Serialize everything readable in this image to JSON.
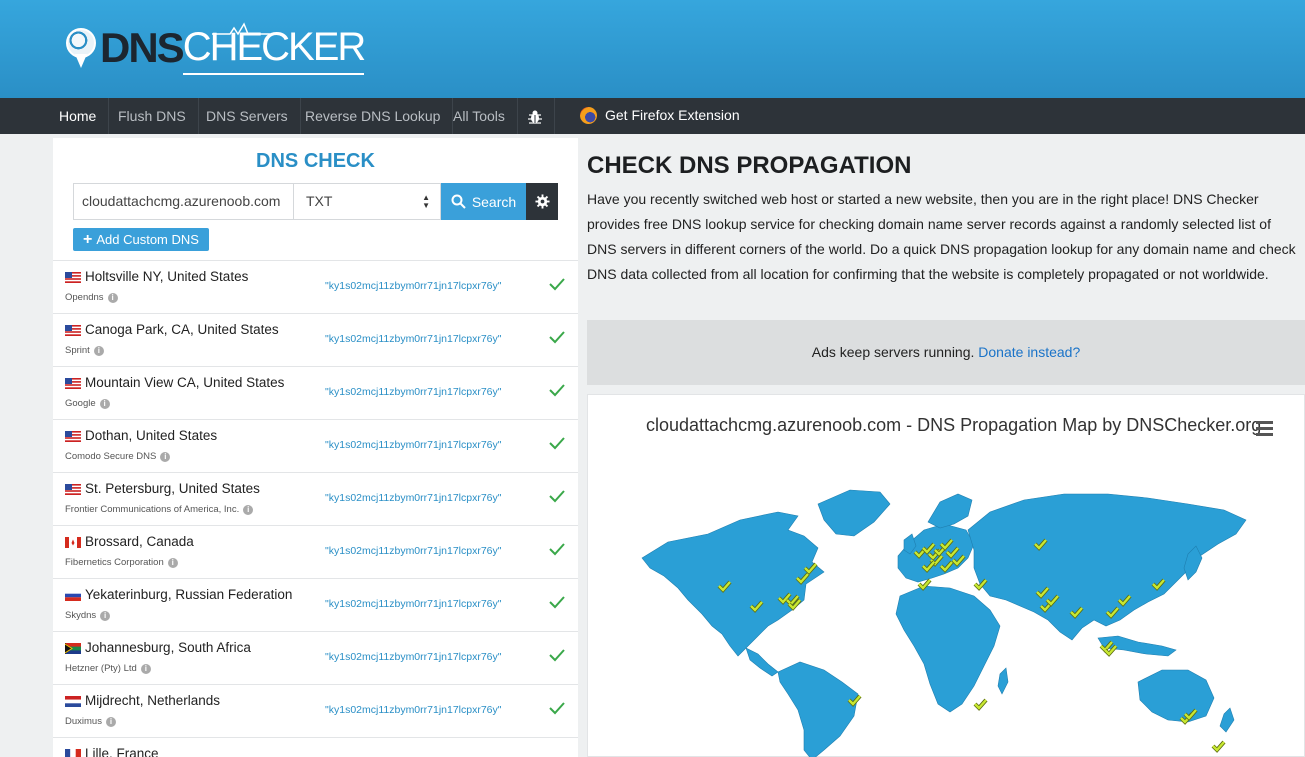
{
  "brand": {
    "part1": "DNS",
    "part2": "CHECKER"
  },
  "nav": {
    "items": [
      {
        "label": "Home"
      },
      {
        "label": "Flush DNS"
      },
      {
        "label": "DNS Servers"
      },
      {
        "label": "Reverse DNS Lookup"
      },
      {
        "label": "All Tools"
      }
    ],
    "firefox_label": "Get Firefox Extension"
  },
  "check": {
    "title": "DNS CHECK",
    "domain_value": "cloudattachcmg.azurenoob.com",
    "record_type": "TXT",
    "search_label": "Search",
    "add_custom_label": "Add Custom DNS"
  },
  "results": [
    {
      "location": "Holtsville NY, United States",
      "provider": "Opendns",
      "value": "\"ky1s02mcj11zbym0rr71jn17lcpxr76y\"",
      "flag": "us"
    },
    {
      "location": "Canoga Park, CA, United States",
      "provider": "Sprint",
      "value": "\"ky1s02mcj11zbym0rr71jn17lcpxr76y\"",
      "flag": "us"
    },
    {
      "location": "Mountain View CA, United States",
      "provider": "Google",
      "value": "\"ky1s02mcj11zbym0rr71jn17lcpxr76y\"",
      "flag": "us"
    },
    {
      "location": "Dothan, United States",
      "provider": "Comodo Secure DNS",
      "value": "\"ky1s02mcj11zbym0rr71jn17lcpxr76y\"",
      "flag": "us"
    },
    {
      "location": "St. Petersburg, United States",
      "provider": "Frontier Communications of America, Inc.",
      "value": "\"ky1s02mcj11zbym0rr71jn17lcpxr76y\"",
      "flag": "us"
    },
    {
      "location": "Brossard, Canada",
      "provider": "Fibernetics Corporation",
      "value": "\"ky1s02mcj11zbym0rr71jn17lcpxr76y\"",
      "flag": "ca"
    },
    {
      "location": "Yekaterinburg, Russian Federation",
      "provider": "Skydns",
      "value": "\"ky1s02mcj11zbym0rr71jn17lcpxr76y\"",
      "flag": "ru"
    },
    {
      "location": "Johannesburg, South Africa",
      "provider": "Hetzner (Pty) Ltd",
      "value": "\"ky1s02mcj11zbym0rr71jn17lcpxr76y\"",
      "flag": "za"
    },
    {
      "location": "Mijdrecht, Netherlands",
      "provider": "Duximus",
      "value": "\"ky1s02mcj11zbym0rr71jn17lcpxr76y\"",
      "flag": "nl"
    },
    {
      "location": "Lille, France",
      "provider": "",
      "value": "",
      "flag": "fr"
    }
  ],
  "propagation": {
    "title": "CHECK DNS PROPAGATION",
    "description": "Have you recently switched web host or started a new website, then you are in the right place! DNS Checker provides free DNS lookup service for checking domain name server records against a randomly selected list of DNS servers in different corners of the world. Do a quick DNS propagation lookup for any domain name and check DNS data collected from all location for confirming that the website is completely propagated or not worldwide.",
    "ads_text": "Ads keep servers running.",
    "ads_link": "Donate instead?",
    "map_title": "cloudattachcmg.azurenoob.com - DNS Propagation Map by DNSChecker.org"
  },
  "colors": {
    "accent": "#3aa0da",
    "nav_bg": "#2d3339",
    "check_green": "#3aa84a",
    "map_land": "#2a9fd6",
    "marker": "#c8e832"
  }
}
